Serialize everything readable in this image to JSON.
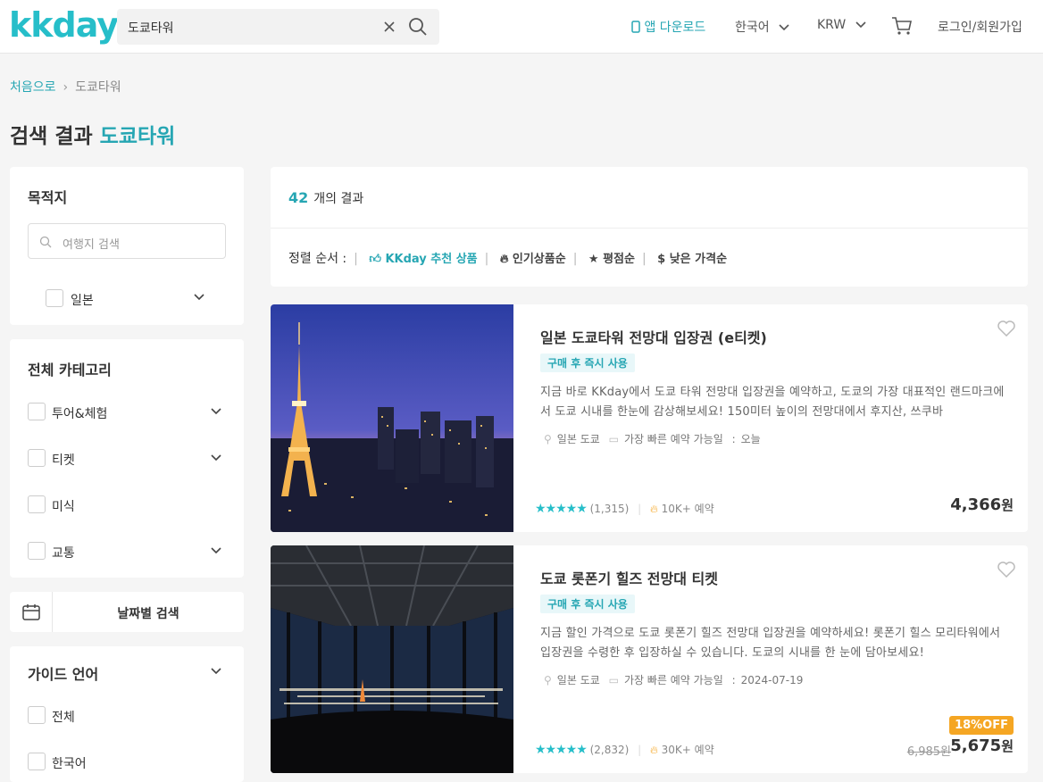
{
  "header": {
    "logo": "kkday",
    "search_value": "도쿄타워",
    "app_download": "앱 다운로드",
    "language": "한국어",
    "currency": "KRW",
    "login": "로그인/회원가입"
  },
  "breadcrumb": {
    "home": "처음으로",
    "current": "도쿄타워"
  },
  "page_title": {
    "prefix": "검색 결과",
    "keyword": "도쿄타워"
  },
  "sidebar": {
    "destination": {
      "title": "목적지",
      "placeholder": "여행지 검색",
      "items": [
        {
          "label": "일본"
        }
      ]
    },
    "category": {
      "title": "전체 카테고리",
      "items": [
        {
          "label": "투어&체험"
        },
        {
          "label": "티켓"
        },
        {
          "label": "미식"
        },
        {
          "label": "교통"
        }
      ]
    },
    "date_search": "날짜별 검색",
    "guide_language": {
      "title": "가이드 언어",
      "items": [
        {
          "label": "전체"
        },
        {
          "label": "한국어"
        }
      ]
    }
  },
  "results": {
    "count": "42",
    "count_suffix": "개의 결과",
    "sort_label": "정렬 순서 :",
    "sort_options": [
      {
        "label": "KKday 추천 상품",
        "icon": "thumbs-up-icon"
      },
      {
        "label": "인기상품순",
        "icon": "fire-icon"
      },
      {
        "label": "평점순",
        "icon": "star-icon"
      },
      {
        "label": "낮은 가격순",
        "icon": "dollar-icon"
      }
    ]
  },
  "products": [
    {
      "title": "일본 도쿄타워 전망대 입장권 (e티켓)",
      "tag": "구매 후 즉시 사용",
      "desc": "지금 바로 KKday에서 도쿄 타워 전망대 입장권을 예약하고, 도쿄의 가장 대표적인 랜드마크에서 도쿄 시내를 한눈에 감상해보세요! 150미터 높이의 전망대에서 후지산, 쓰쿠바",
      "location": "일본 도쿄",
      "booking_label": "가장 빠른 예약 가능일",
      "booking_date": "오늘",
      "rating": 5,
      "reviews": "(1,315)",
      "booked": "10K+ 예약",
      "price": "4,366",
      "currency_unit": "원"
    },
    {
      "title": "도쿄 롯폰기 힐즈 전망대 티켓",
      "tag": "구매 후 즉시 사용",
      "desc": "지금 할인 가격으로 도쿄 롯폰기 힐즈 전망대 입장권을 예약하세요! 롯폰기 힐스 모리타워에서 입장권을 수령한 후 입장하실 수 있습니다. 도쿄의 시내를 한 눈에 담아보세요!",
      "location": "일본 도쿄",
      "booking_label": "가장 빠른 예약 가능일",
      "booking_date": "2024-07-19",
      "rating": 5,
      "reviews": "(2,832)",
      "booked": "30K+ 예약",
      "discount": "18%OFF",
      "old_price": "6,985원",
      "price": "5,675",
      "currency_unit": "원"
    }
  ],
  "colors": {
    "brand": "#26bec9",
    "accent_text": "#26a6b3",
    "discount": "#f5a623"
  }
}
